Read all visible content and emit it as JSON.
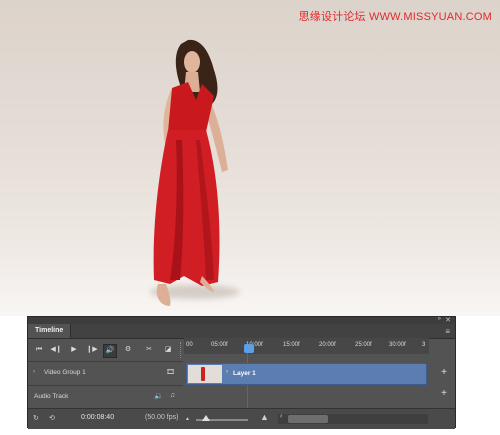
{
  "watermark": "思缘设计论坛 WWW.MISSYUAN.COM",
  "timeline": {
    "tab_label": "Timeline",
    "menu_icon": "≡",
    "close_icon": "✕",
    "collapse_icon": "»",
    "controls": {
      "first_frame": "⏮",
      "prev_frame": "◀❙",
      "play": "▶",
      "next_frame": "❙▶",
      "audio": "🔊",
      "settings": "⚙",
      "split": "✂",
      "transition": "◪"
    },
    "ruler_ticks": [
      "00",
      "05:00f",
      "10:00f",
      "15:00f",
      "20:00f",
      "25:00f",
      "30:00f",
      "3"
    ],
    "video_group_label": "Video Group 1",
    "audio_track_label": "Audio Track",
    "clip_label": "Layer 1",
    "timecode": "0:00:08:40",
    "fps": "(50.00 fps)",
    "add_plus": "+",
    "expand_caret": "›",
    "film_icon": "🎞",
    "note_icon": "♫",
    "speaker_icon": "🔉",
    "render_icon": "↻",
    "loop_icon": "⟲",
    "mountain_small": "▲",
    "mountain_large": "▲",
    "scroll_left": "‹"
  }
}
